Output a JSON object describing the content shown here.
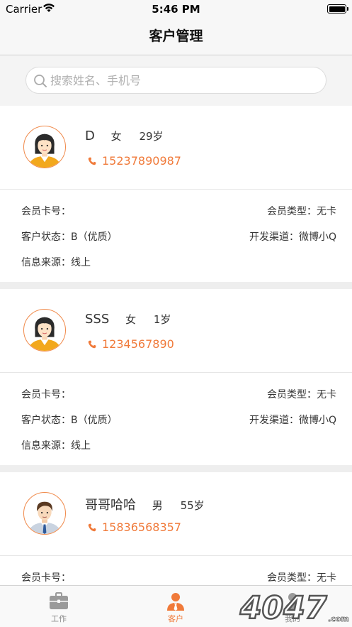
{
  "status_bar": {
    "carrier": "Carrier",
    "time": "5:46 PM"
  },
  "nav": {
    "title": "客户管理"
  },
  "search": {
    "placeholder": "搜索姓名、手机号"
  },
  "labels": {
    "card_no": "会员卡号：",
    "member_type": "会员类型：",
    "status": "客户状态：",
    "channel": "开发渠道：",
    "source": "信息来源："
  },
  "customers": [
    {
      "name": "D",
      "gender": "女",
      "age": "29岁",
      "phone": "15237890987",
      "card_no": "",
      "member_type": "无卡",
      "status": "B（优质）",
      "channel": "微博小Q",
      "source": "线上",
      "avatar": "female"
    },
    {
      "name": "SSS",
      "gender": "女",
      "age": "1岁",
      "phone": "1234567890",
      "card_no": "",
      "member_type": "无卡",
      "status": "B（优质）",
      "channel": "微博小Q",
      "source": "线上",
      "avatar": "female"
    },
    {
      "name": "哥哥哈哈",
      "gender": "男",
      "age": "55岁",
      "phone": "15836568357",
      "card_no": "",
      "member_type": "无卡",
      "avatar": "male"
    }
  ],
  "tabs": [
    {
      "label": "工作",
      "icon": "briefcase-icon",
      "active": false
    },
    {
      "label": "客户",
      "icon": "customer-icon",
      "active": true
    },
    {
      "label": "我的",
      "icon": "person-icon",
      "active": false
    }
  ],
  "watermark": {
    "text": "4047",
    "domain": ".com"
  },
  "colors": {
    "accent": "#f07a3a",
    "avatar_border": "#f08a4b",
    "bg_gray": "#eeeeee"
  }
}
